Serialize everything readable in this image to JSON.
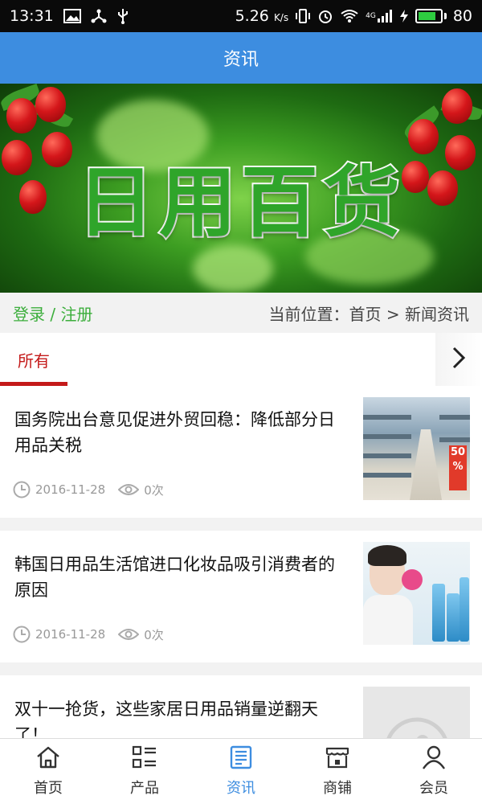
{
  "status_bar": {
    "time": "13:31",
    "speed": "5.26",
    "speed_unit": "K/s",
    "network": "4G",
    "battery": "80",
    "battery_level": 0.8
  },
  "header": {
    "title": "资讯"
  },
  "banner": {
    "title": "日用百货"
  },
  "breadcrumb": {
    "auth": "登录 / 注册",
    "location": "当前位置：首页 > 新闻资讯"
  },
  "tabs": {
    "active_label": "所有"
  },
  "news": [
    {
      "title": "国务院出台意见促进外贸回稳：降低部分日用品关税",
      "date": "2016-11-28",
      "views": "0次",
      "thumb": "supermarket-aisle"
    },
    {
      "title": "韩国日用品生活馆进口化妆品吸引消费者的原因",
      "date": "2016-11-28",
      "views": "0次",
      "thumb": "cosmetics-ad"
    },
    {
      "title": "双十一抢货，这些家居日用品销量逆翻天了！",
      "thumb": "image-placeholder"
    }
  ],
  "bottom_nav": [
    {
      "label": "首页",
      "icon": "home-icon"
    },
    {
      "label": "产品",
      "icon": "list-icon"
    },
    {
      "label": "资讯",
      "icon": "news-icon",
      "active": true
    },
    {
      "label": "商铺",
      "icon": "store-icon"
    },
    {
      "label": "会员",
      "icon": "user-icon"
    }
  ],
  "colors": {
    "header": "#3d8de0",
    "active_tab": "#c41a1a",
    "login_link": "#3cae3c",
    "nav_active": "#3d8de0"
  }
}
